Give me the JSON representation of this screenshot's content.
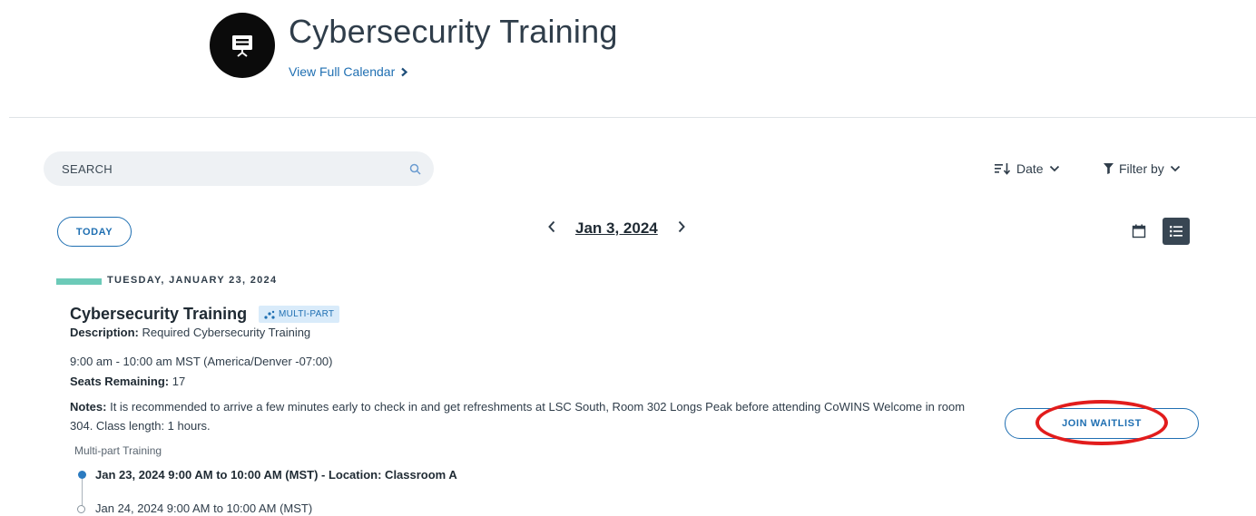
{
  "header": {
    "title": "Cybersecurity Training",
    "view_calendar_label": "View Full Calendar",
    "logo_icon": "presentation-board-icon"
  },
  "search": {
    "placeholder": "SEARCH"
  },
  "sort": {
    "label": "Date"
  },
  "filter": {
    "label": "Filter by"
  },
  "nav": {
    "today_label": "TODAY",
    "current_date": "Jan 3, 2024",
    "prev_icon": "chevron-left-icon",
    "next_icon": "chevron-right-icon"
  },
  "view_toggle": {
    "calendar_icon": "calendar-icon",
    "list_icon": "list-icon",
    "active": "list"
  },
  "day": {
    "label": "TUESDAY, JANUARY 23, 2024"
  },
  "event": {
    "title": "Cybersecurity Training",
    "badge": "MULTI-PART",
    "description_label": "Description:",
    "description": "Required Cybersecurity Training",
    "time": "9:00 am - 10:00 am MST (America/Denver -07:00)",
    "seats_label": "Seats Remaining:",
    "seats": "17",
    "notes_label": "Notes:",
    "notes": "It is recommended to arrive a few minutes early to check in and get refreshments at LSC South, Room 302 Longs Peak before attending CoWINS Welcome in room 304. Class length: 1 hours.",
    "action_label": "JOIN WAITLIST",
    "multipart_heading": "Multi-part Training",
    "parts": [
      {
        "text": "Jan 23, 2024 9:00 AM to 10:00 AM (MST) - Location: Classroom A"
      },
      {
        "text": "Jan 24, 2024 9:00 AM to 10:00 AM (MST)"
      }
    ]
  },
  "colors": {
    "accent": "#1f6fb2",
    "day_bar": "#6ccab8",
    "highlight": "#e21c1c"
  }
}
